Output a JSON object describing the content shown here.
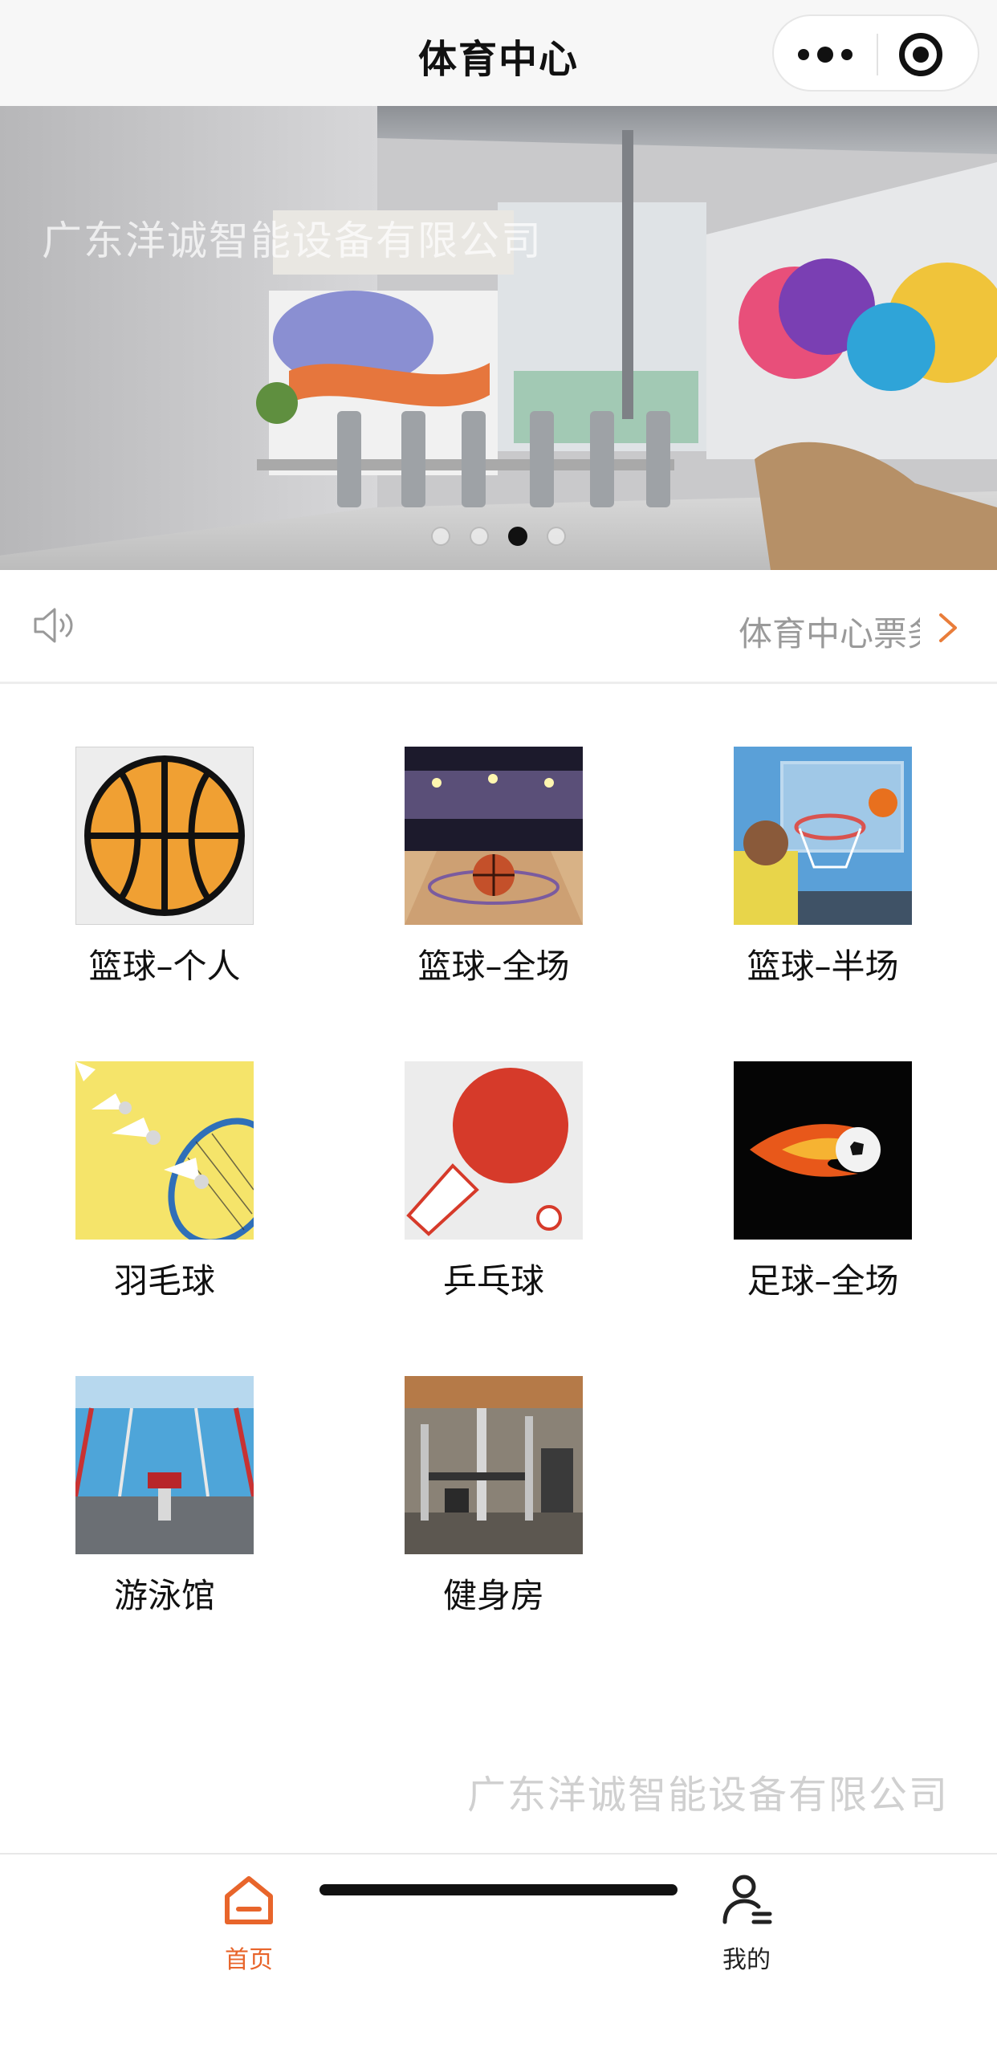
{
  "header": {
    "title": "体育中心",
    "more_icon": "more-dots-icon",
    "close_icon": "target-circle-icon"
  },
  "banner": {
    "watermark": "广东洋诚智能设备有限公司",
    "slide_count": 4,
    "active_slide": 3
  },
  "notice": {
    "icon": "speaker-icon",
    "text": "体育中心票务",
    "arrow_icon": "chevron-right-icon",
    "accent_color": "#e97d3a"
  },
  "grid": {
    "items": [
      {
        "label": "篮球–个人",
        "icon": "basketball-icon"
      },
      {
        "label": "篮球–全场",
        "icon": "basketball-court-image"
      },
      {
        "label": "篮球–半场",
        "icon": "basketball-hoop-image"
      },
      {
        "label": "羽毛球",
        "icon": "badminton-image"
      },
      {
        "label": "乒乓球",
        "icon": "ping-pong-paddle-icon"
      },
      {
        "label": "足球–全场",
        "icon": "football-fire-image"
      },
      {
        "label": "游泳馆",
        "icon": "swimming-pool-image"
      },
      {
        "label": "健身房",
        "icon": "gym-image"
      }
    ]
  },
  "page_watermark": "广东洋诚智能设备有限公司",
  "tabbar": {
    "tabs": [
      {
        "label": "首页",
        "icon": "home-icon",
        "active": true,
        "color": "#e8652b"
      },
      {
        "label": "我的",
        "icon": "user-icon",
        "active": false,
        "color": "#222222"
      }
    ]
  }
}
